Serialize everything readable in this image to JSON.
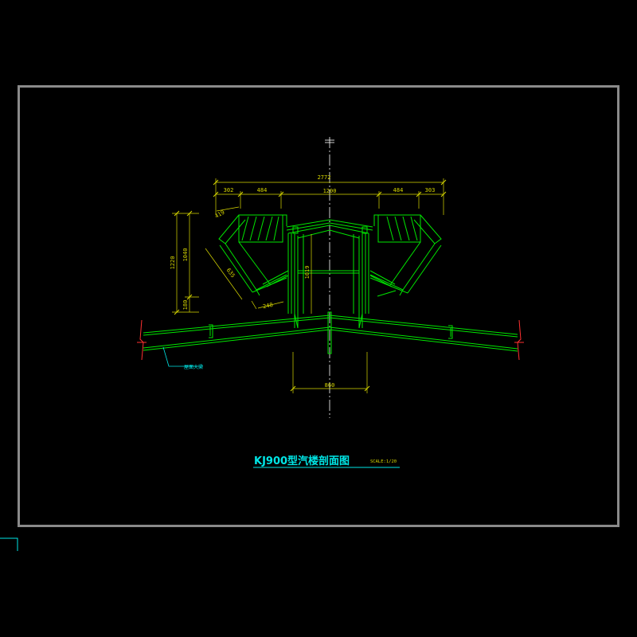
{
  "drawing": {
    "title": "KJ900型汽楼剖面图",
    "scale": "SCALE:1/20",
    "callout": "屋面大梁",
    "colors": {
      "background": "#000000",
      "frame": "#8a8a8a",
      "structure": "#00e600",
      "dimension": "#d8d800",
      "annotation": "#00e6e6",
      "centerline": "#ffffff",
      "break_mark": "#ff3030"
    }
  },
  "dimensions": {
    "overall_width": "2772",
    "top_left_outer": "302",
    "top_left_inner": "484",
    "top_center": "1200",
    "top_right_inner": "484",
    "top_right_outer": "303",
    "left_total_height": "1220",
    "left_height": "1040",
    "left_bottom": "180",
    "center_height": "1019",
    "slope_top": "419",
    "slope_length": "635",
    "slope_bottom": "248",
    "bottom_width": "860"
  }
}
